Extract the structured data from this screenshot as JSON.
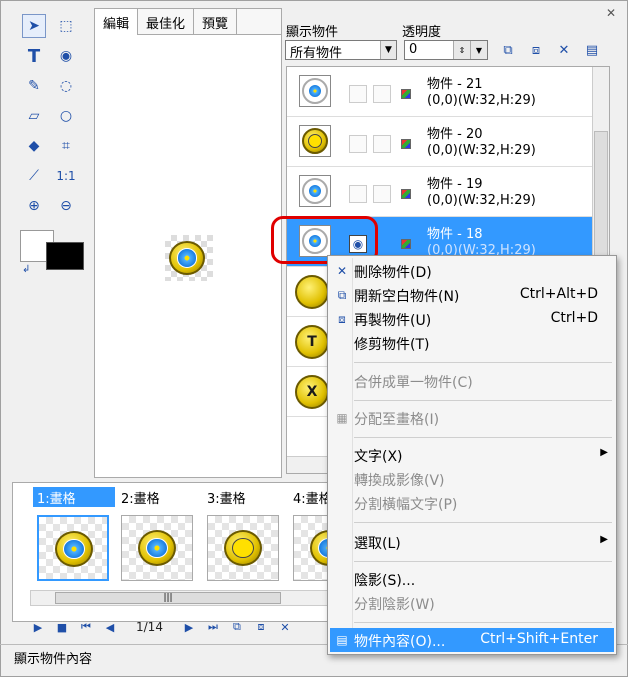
{
  "editor_tabs": [
    "編輯",
    "最佳化",
    "預覽"
  ],
  "panel": {
    "show_label": "顯示物件",
    "show_value": "所有物件",
    "opacity_label": "透明度",
    "opacity_value": "0"
  },
  "objects": [
    {
      "name": "物件 - 21",
      "info": "(0,0)(W:32,H:29)",
      "thumb": "flower"
    },
    {
      "name": "物件 - 20",
      "info": "(0,0)(W:32,H:29)",
      "thumb": "smile"
    },
    {
      "name": "物件 - 19",
      "info": "(0,0)(W:32,H:29)",
      "thumb": "flower"
    },
    {
      "name": "物件 - 18",
      "info": "(0,0)(W:32,H:29)",
      "thumb": "flower"
    }
  ],
  "frames": [
    "1:畫格",
    "2:畫格",
    "3:畫格",
    "4:畫格"
  ],
  "nav": {
    "page": "1/14"
  },
  "status": "顯示物件內容",
  "menu": {
    "delete": {
      "label": "刪除物件(D)"
    },
    "new_blank": {
      "label": "開新空白物件(N)",
      "shortcut": "Ctrl+Alt+D"
    },
    "duplicate": {
      "label": "再製物件(U)",
      "shortcut": "Ctrl+D"
    },
    "trim": {
      "label": "修剪物件(T)"
    },
    "merge": {
      "label": "合併成單一物件(C)"
    },
    "assign": {
      "label": "分配至畫格(I)"
    },
    "text": {
      "label": "文字(X)"
    },
    "to_image": {
      "label": "轉換成影像(V)"
    },
    "split_text": {
      "label": "分割橫幅文字(P)"
    },
    "select": {
      "label": "選取(L)"
    },
    "shadow": {
      "label": "陰影(S)..."
    },
    "split_shadow": {
      "label": "分割陰影(W)"
    },
    "properties": {
      "label": "物件內容(O)...",
      "shortcut": "Ctrl+Shift+Enter"
    }
  }
}
